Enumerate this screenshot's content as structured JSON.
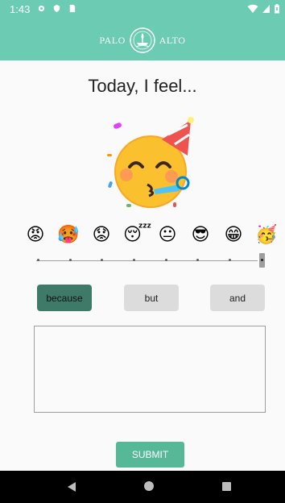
{
  "status_bar": {
    "time": "1:43",
    "left_icons": [
      "gear-icon",
      "shield-icon",
      "sim-card-icon"
    ],
    "right_icons": [
      "wifi-icon",
      "signal-icon",
      "battery-icon"
    ]
  },
  "header": {
    "logo_left": "PALO",
    "logo_right": "ALTO",
    "logo_icon": "palo-alto-seal"
  },
  "mood": {
    "prompt": "Today, I feel...",
    "selected_emoji": "🥳",
    "options": [
      "😡",
      "🥵",
      "😟",
      "😴",
      "😐",
      "😎",
      "😁",
      "🥳"
    ],
    "selected_index": 7
  },
  "conjunctions": {
    "items": [
      "because",
      "but",
      "and"
    ],
    "selected": "because"
  },
  "note_field": {
    "value": "",
    "placeholder": ""
  },
  "submit": {
    "label": "SUBMIT"
  },
  "colors": {
    "header": "#6ccbb3",
    "selected_conjunction": "#3f7a68",
    "unselected_conjunction": "#dcdcdc",
    "submit": "#57b897"
  }
}
